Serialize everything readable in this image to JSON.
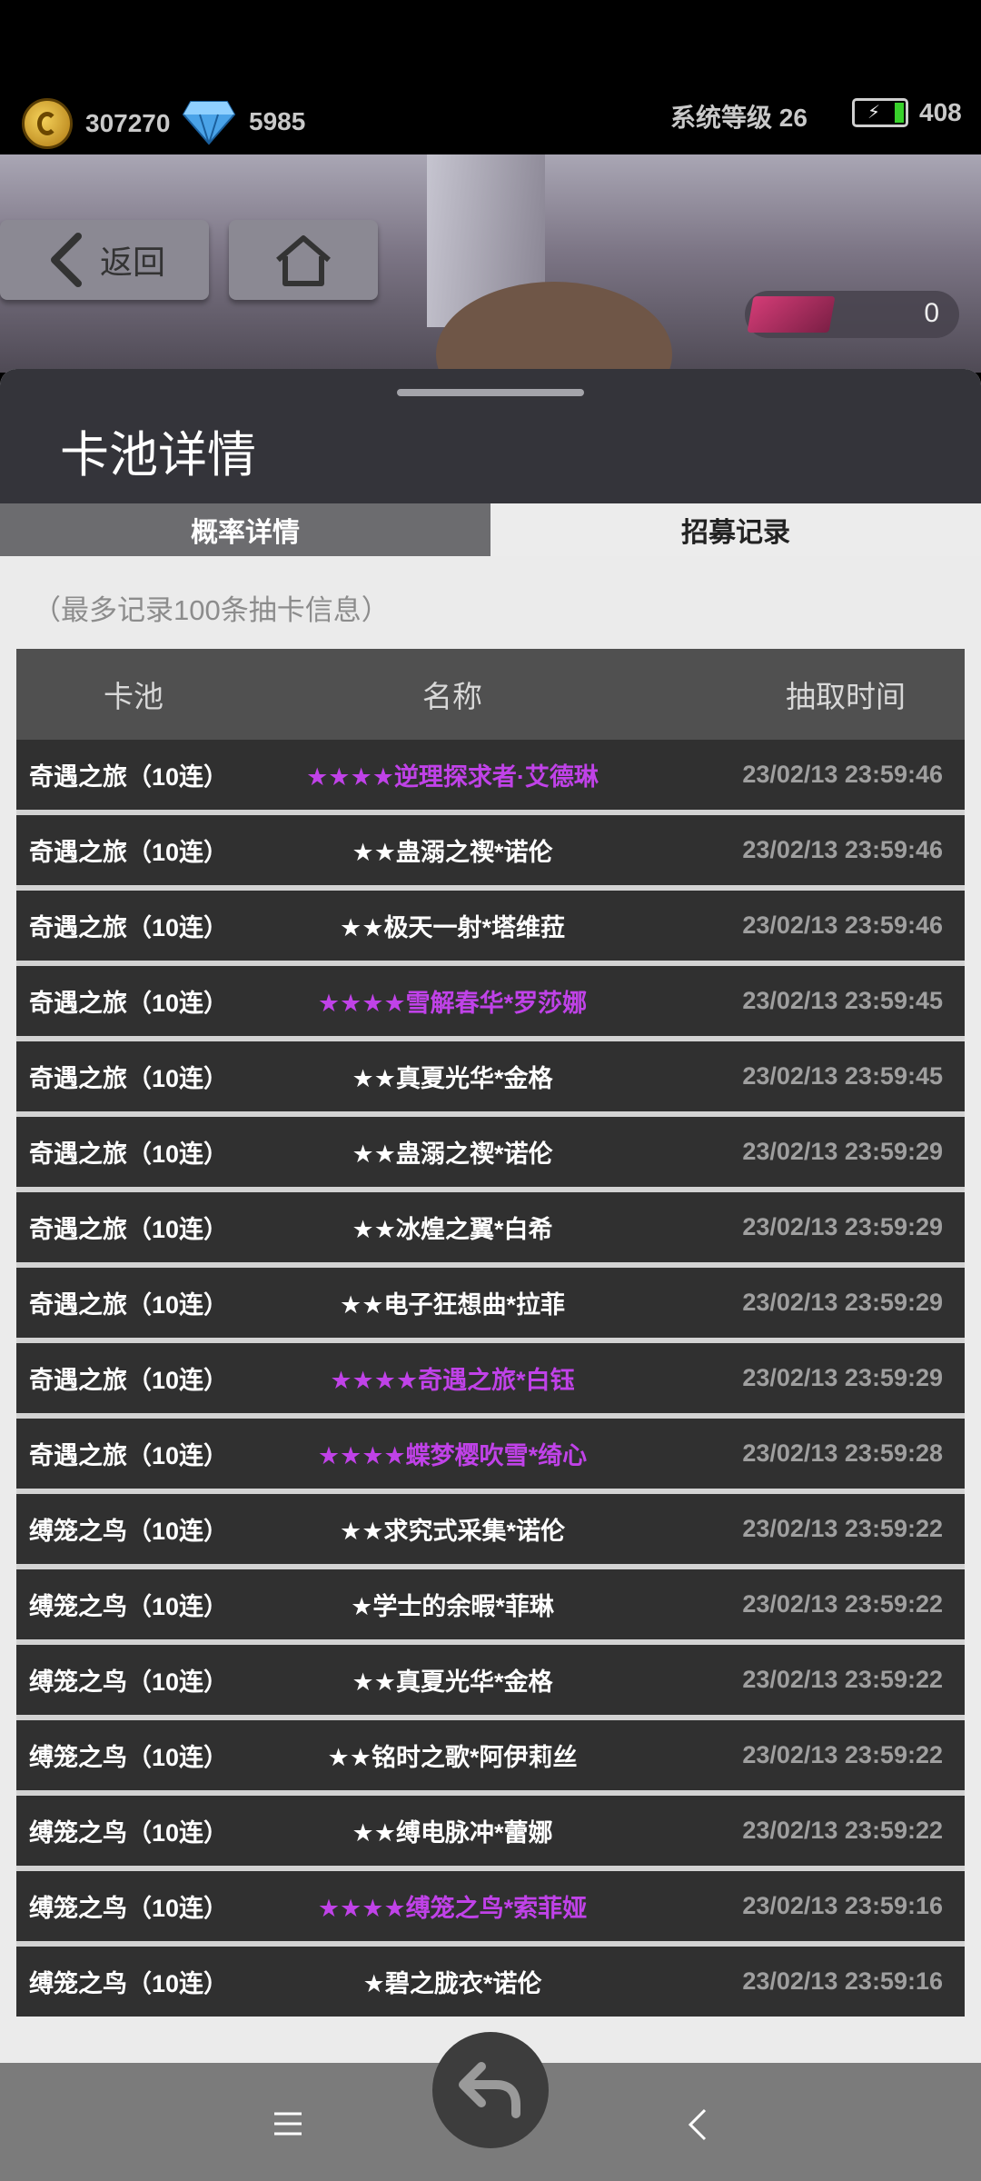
{
  "top": {
    "coins": "307270",
    "gems": "5985",
    "system_level": "系统等级 26",
    "energy": "408"
  },
  "nav": {
    "back_label": "返回",
    "ticket_count": "0"
  },
  "panel": {
    "title": "卡池详情",
    "tabs": [
      "概率详情",
      "招募记录"
    ],
    "active_tab": "招募记录",
    "note": "（最多记录100条抽卡信息）"
  },
  "table": {
    "headers": [
      "卡池",
      "名称",
      "抽取时间"
    ],
    "rows": [
      {
        "pool": "奇遇之旅（10连）",
        "name": "★★★★逆理探求者·艾德琳",
        "time": "23/02/13 23:59:46",
        "rare": true
      },
      {
        "pool": "奇遇之旅（10连）",
        "name": "★★蛊溺之禊*诺伦",
        "time": "23/02/13 23:59:46",
        "rare": false
      },
      {
        "pool": "奇遇之旅（10连）",
        "name": "★★极天一射*塔维菈",
        "time": "23/02/13 23:59:46",
        "rare": false
      },
      {
        "pool": "奇遇之旅（10连）",
        "name": "★★★★雪解春华*罗莎娜",
        "time": "23/02/13 23:59:45",
        "rare": true
      },
      {
        "pool": "奇遇之旅（10连）",
        "name": "★★真夏光华*金格",
        "time": "23/02/13 23:59:45",
        "rare": false
      },
      {
        "pool": "奇遇之旅（10连）",
        "name": "★★蛊溺之禊*诺伦",
        "time": "23/02/13 23:59:29",
        "rare": false
      },
      {
        "pool": "奇遇之旅（10连）",
        "name": "★★冰煌之翼*白希",
        "time": "23/02/13 23:59:29",
        "rare": false
      },
      {
        "pool": "奇遇之旅（10连）",
        "name": "★★电子狂想曲*拉菲",
        "time": "23/02/13 23:59:29",
        "rare": false
      },
      {
        "pool": "奇遇之旅（10连）",
        "name": "★★★★奇遇之旅*白钰",
        "time": "23/02/13 23:59:29",
        "rare": true
      },
      {
        "pool": "奇遇之旅（10连）",
        "name": "★★★★蝶梦樱吹雪*绮心",
        "time": "23/02/13 23:59:28",
        "rare": true
      },
      {
        "pool": "缚笼之鸟（10连）",
        "name": "★★求究式采集*诺伦",
        "time": "23/02/13 23:59:22",
        "rare": false
      },
      {
        "pool": "缚笼之鸟（10连）",
        "name": "★学士的余暇*菲琳",
        "time": "23/02/13 23:59:22",
        "rare": false
      },
      {
        "pool": "缚笼之鸟（10连）",
        "name": "★★真夏光华*金格",
        "time": "23/02/13 23:59:22",
        "rare": false
      },
      {
        "pool": "缚笼之鸟（10连）",
        "name": "★★铭时之歌*阿伊莉丝",
        "time": "23/02/13 23:59:22",
        "rare": false
      },
      {
        "pool": "缚笼之鸟（10连）",
        "name": "★★缚电脉冲*蕾娜",
        "time": "23/02/13 23:59:22",
        "rare": false
      },
      {
        "pool": "缚笼之鸟（10连）",
        "name": "★★★★缚笼之鸟*索菲娅",
        "time": "23/02/13 23:59:16",
        "rare": true
      },
      {
        "pool": "缚笼之鸟（10连）",
        "name": "★碧之胧衣*诺伦",
        "time": "23/02/13 23:59:16",
        "rare": false
      }
    ]
  },
  "colors": {
    "rare": "#c042e8",
    "common": "#ffffff",
    "row_bg": "#303030",
    "header_bg": "#505050"
  }
}
